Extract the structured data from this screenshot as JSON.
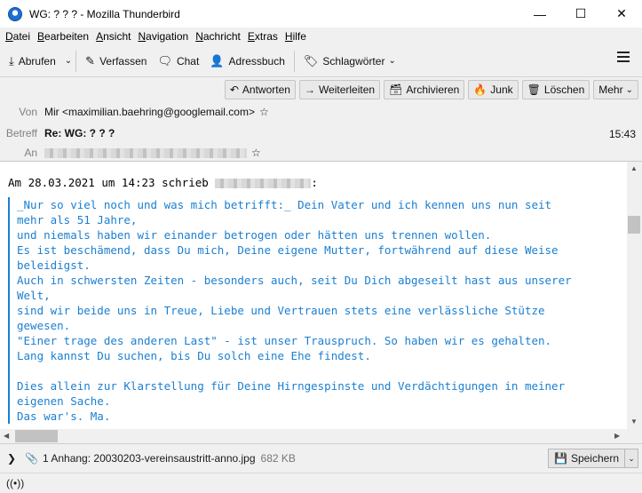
{
  "window": {
    "title": "WG: ? ? ? - Mozilla Thunderbird",
    "controls": [
      "—",
      "☐",
      "✕"
    ]
  },
  "menu": [
    {
      "label": "Datei",
      "key": "D",
      "rest": "atei"
    },
    {
      "label": "Bearbeiten",
      "key": "B",
      "rest": "earbeiten"
    },
    {
      "label": "Ansicht",
      "key": "A",
      "rest": "nsicht"
    },
    {
      "label": "Navigation",
      "key": "N",
      "rest": "avigation"
    },
    {
      "label": "Nachricht",
      "key": "N",
      "rest": "achricht"
    },
    {
      "label": "Extras",
      "key": "E",
      "rest": "xtras"
    },
    {
      "label": "Hilfe",
      "key": "H",
      "rest": "ilfe"
    }
  ],
  "toolbar": {
    "get_mail": "Abrufen",
    "compose": "Verfassen",
    "chat": "Chat",
    "address_book": "Adressbuch",
    "tags": "Schlagwörter"
  },
  "header_actions": {
    "reply": "Antworten",
    "forward": "Weiterleiten",
    "archive": "Archivieren",
    "junk": "Junk",
    "delete": "Löschen",
    "more": "Mehr"
  },
  "message": {
    "from_label": "Von",
    "from_value": "Mir <maximilian.baehring@googlemail.com>",
    "subject_label": "Betreff",
    "subject_value": "Re: WG: ? ? ?",
    "to_label": "An",
    "time": "15:43"
  },
  "body": {
    "intro_prefix": "Am 28.03.2021 um 14:23 schrieb",
    "intro_suffix": ":",
    "quote_lines": [
      "_Nur so viel noch und was mich betrifft:_ Dein Vater und ich kennen uns nun seit",
      "mehr als 51 Jahre,",
      "und niemals haben wir einander betrogen oder hätten uns trennen wollen.",
      "Es ist beschämend, dass Du mich, Deine eigene Mutter, fortwährend auf diese Weise",
      "beleidigst.",
      "Auch in schwersten Zeiten - besonders auch, seit Du Dich abgeseilt hast aus unserer",
      "Welt,",
      "sind wir beide uns in Treue, Liebe und Vertrauen stets eine verlässliche Stütze",
      "gewesen.",
      "\"Einer trage des anderen Last\" - ist unser Trauspruch. So haben wir es gehalten.",
      "Lang kannst Du suchen, bis Du solch eine Ehe findest.",
      "",
      "Dies allein zur Klarstellung für Deine Hirngespinste und Verdächtigungen in meiner",
      "eigenen Sache.",
      "Das war's. Ma."
    ]
  },
  "attachment": {
    "summary": "1 Anhang: 20030203-vereinsaustritt-anno.jpg",
    "size": "682 KB",
    "save_label": "Speichern"
  },
  "colors": {
    "quote": "#1b7fd1",
    "label": "#808080",
    "chrome": "#f0f0f0"
  }
}
